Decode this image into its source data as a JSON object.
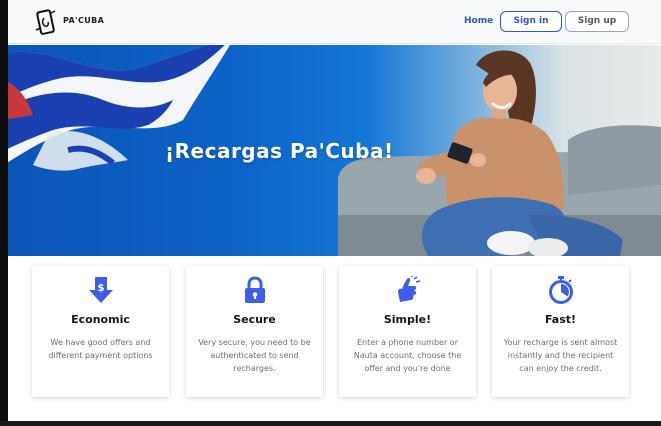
{
  "header": {
    "brand": "PA'CUBA",
    "logo_icon": "phone-logo-icon",
    "nav": {
      "home": "Home",
      "sign_in": "Sign in",
      "sign_up": "Sign up"
    }
  },
  "hero": {
    "title": "¡Recargas Pa'Cuba!",
    "image": "woman-on-sofa-with-phone-and-cuban-flag"
  },
  "features": [
    {
      "icon": "dollar-down-arrow-icon",
      "title": "Economic",
      "description": "We have good offers and different payment options"
    },
    {
      "icon": "padlock-icon",
      "title": "Secure",
      "description": "Very secure, you need to be authenticated to send recharges."
    },
    {
      "icon": "pointing-hand-icon",
      "title": "Simple!",
      "description": "Enter a phone number or Nauta account, choose the offer and you're done"
    },
    {
      "icon": "stopwatch-icon",
      "title": "Fast!",
      "description": "Your recharge is sent almost instantly and the recipient can enjoy the credit."
    }
  ],
  "colors": {
    "accent": "#2f55d4",
    "icon_blue": "#3d5ee8",
    "hero_blue": "#0d63c8"
  }
}
